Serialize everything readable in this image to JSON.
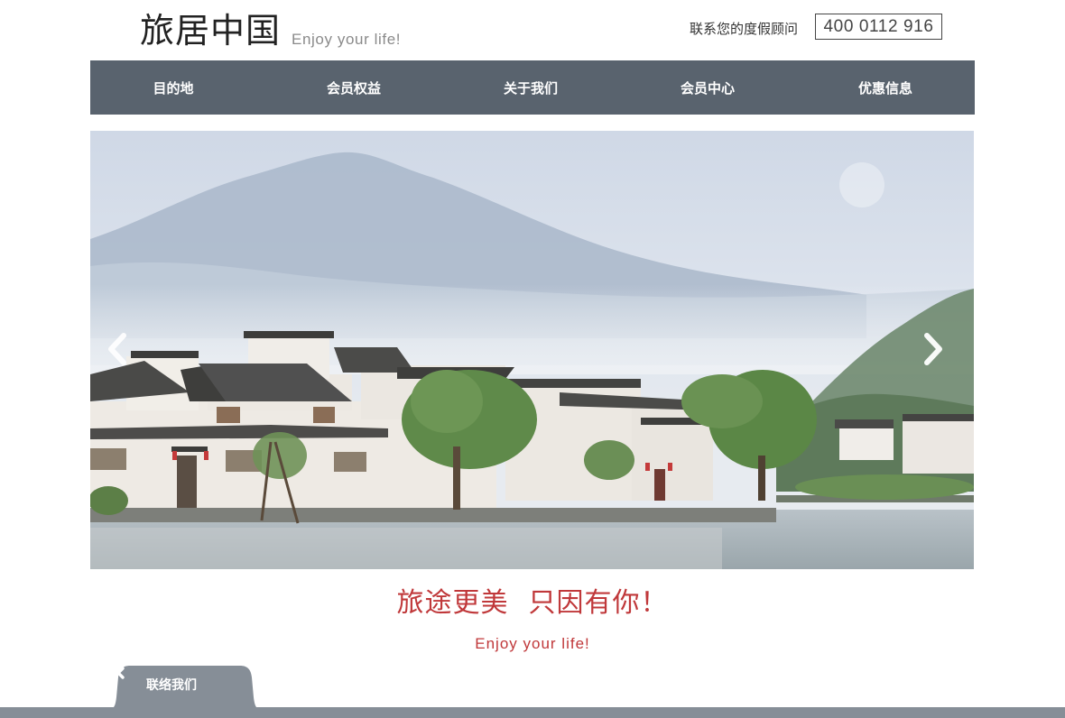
{
  "header": {
    "logo_cn": "旅居中国",
    "logo_en": "Enjoy your life!",
    "contact_label": "联系您的度假顾问",
    "phone": "400 0112 916"
  },
  "nav": {
    "items": [
      {
        "label": "目的地"
      },
      {
        "label": "会员权益"
      },
      {
        "label": "关于我们"
      },
      {
        "label": "会员中心"
      },
      {
        "label": "优惠信息"
      }
    ]
  },
  "carousel": {
    "prev_icon": "chevron-left-icon",
    "next_icon": "chevron-right-icon"
  },
  "slogan": {
    "main_part1": "旅途更美",
    "main_part2": "只因有你！",
    "sub": "Enjoy your life!"
  },
  "contact_tab": {
    "label": "联络我们",
    "close_icon": "close-icon"
  },
  "colors": {
    "nav_bg": "#59636e",
    "accent_red": "#c0383a",
    "tab_bg": "#868e97"
  }
}
